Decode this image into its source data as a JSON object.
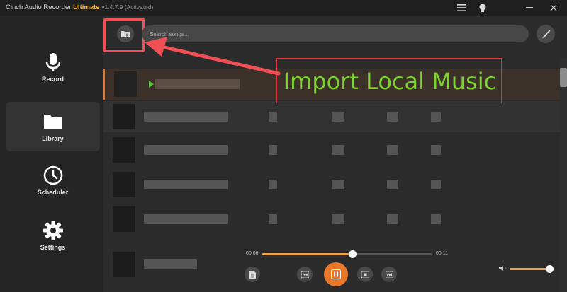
{
  "window": {
    "title_prefix": "Cinch Audio Recorder",
    "title_brand": "Ultimate",
    "version": "v1.4.7.9 (Activated)"
  },
  "sidebar": {
    "items": [
      {
        "label": "Record",
        "icon": "microphone-icon"
      },
      {
        "label": "Library",
        "icon": "folder-icon",
        "active": true
      },
      {
        "label": "Scheduler",
        "icon": "clock-icon"
      },
      {
        "label": "Settings",
        "icon": "gear-icon"
      }
    ]
  },
  "toolbar": {
    "search_placeholder": "Search songs...",
    "add_icon": "folder-add-icon",
    "clean_icon": "brush-icon"
  },
  "annotation": {
    "text": "Import Local Music"
  },
  "player": {
    "elapsed": "00:06",
    "duration": "00:11",
    "progress": 0.53,
    "volume": 0.9
  },
  "colors": {
    "accent": "#e9772a",
    "highlight": "#ef4f55",
    "annotation_text": "#7bd42a"
  }
}
